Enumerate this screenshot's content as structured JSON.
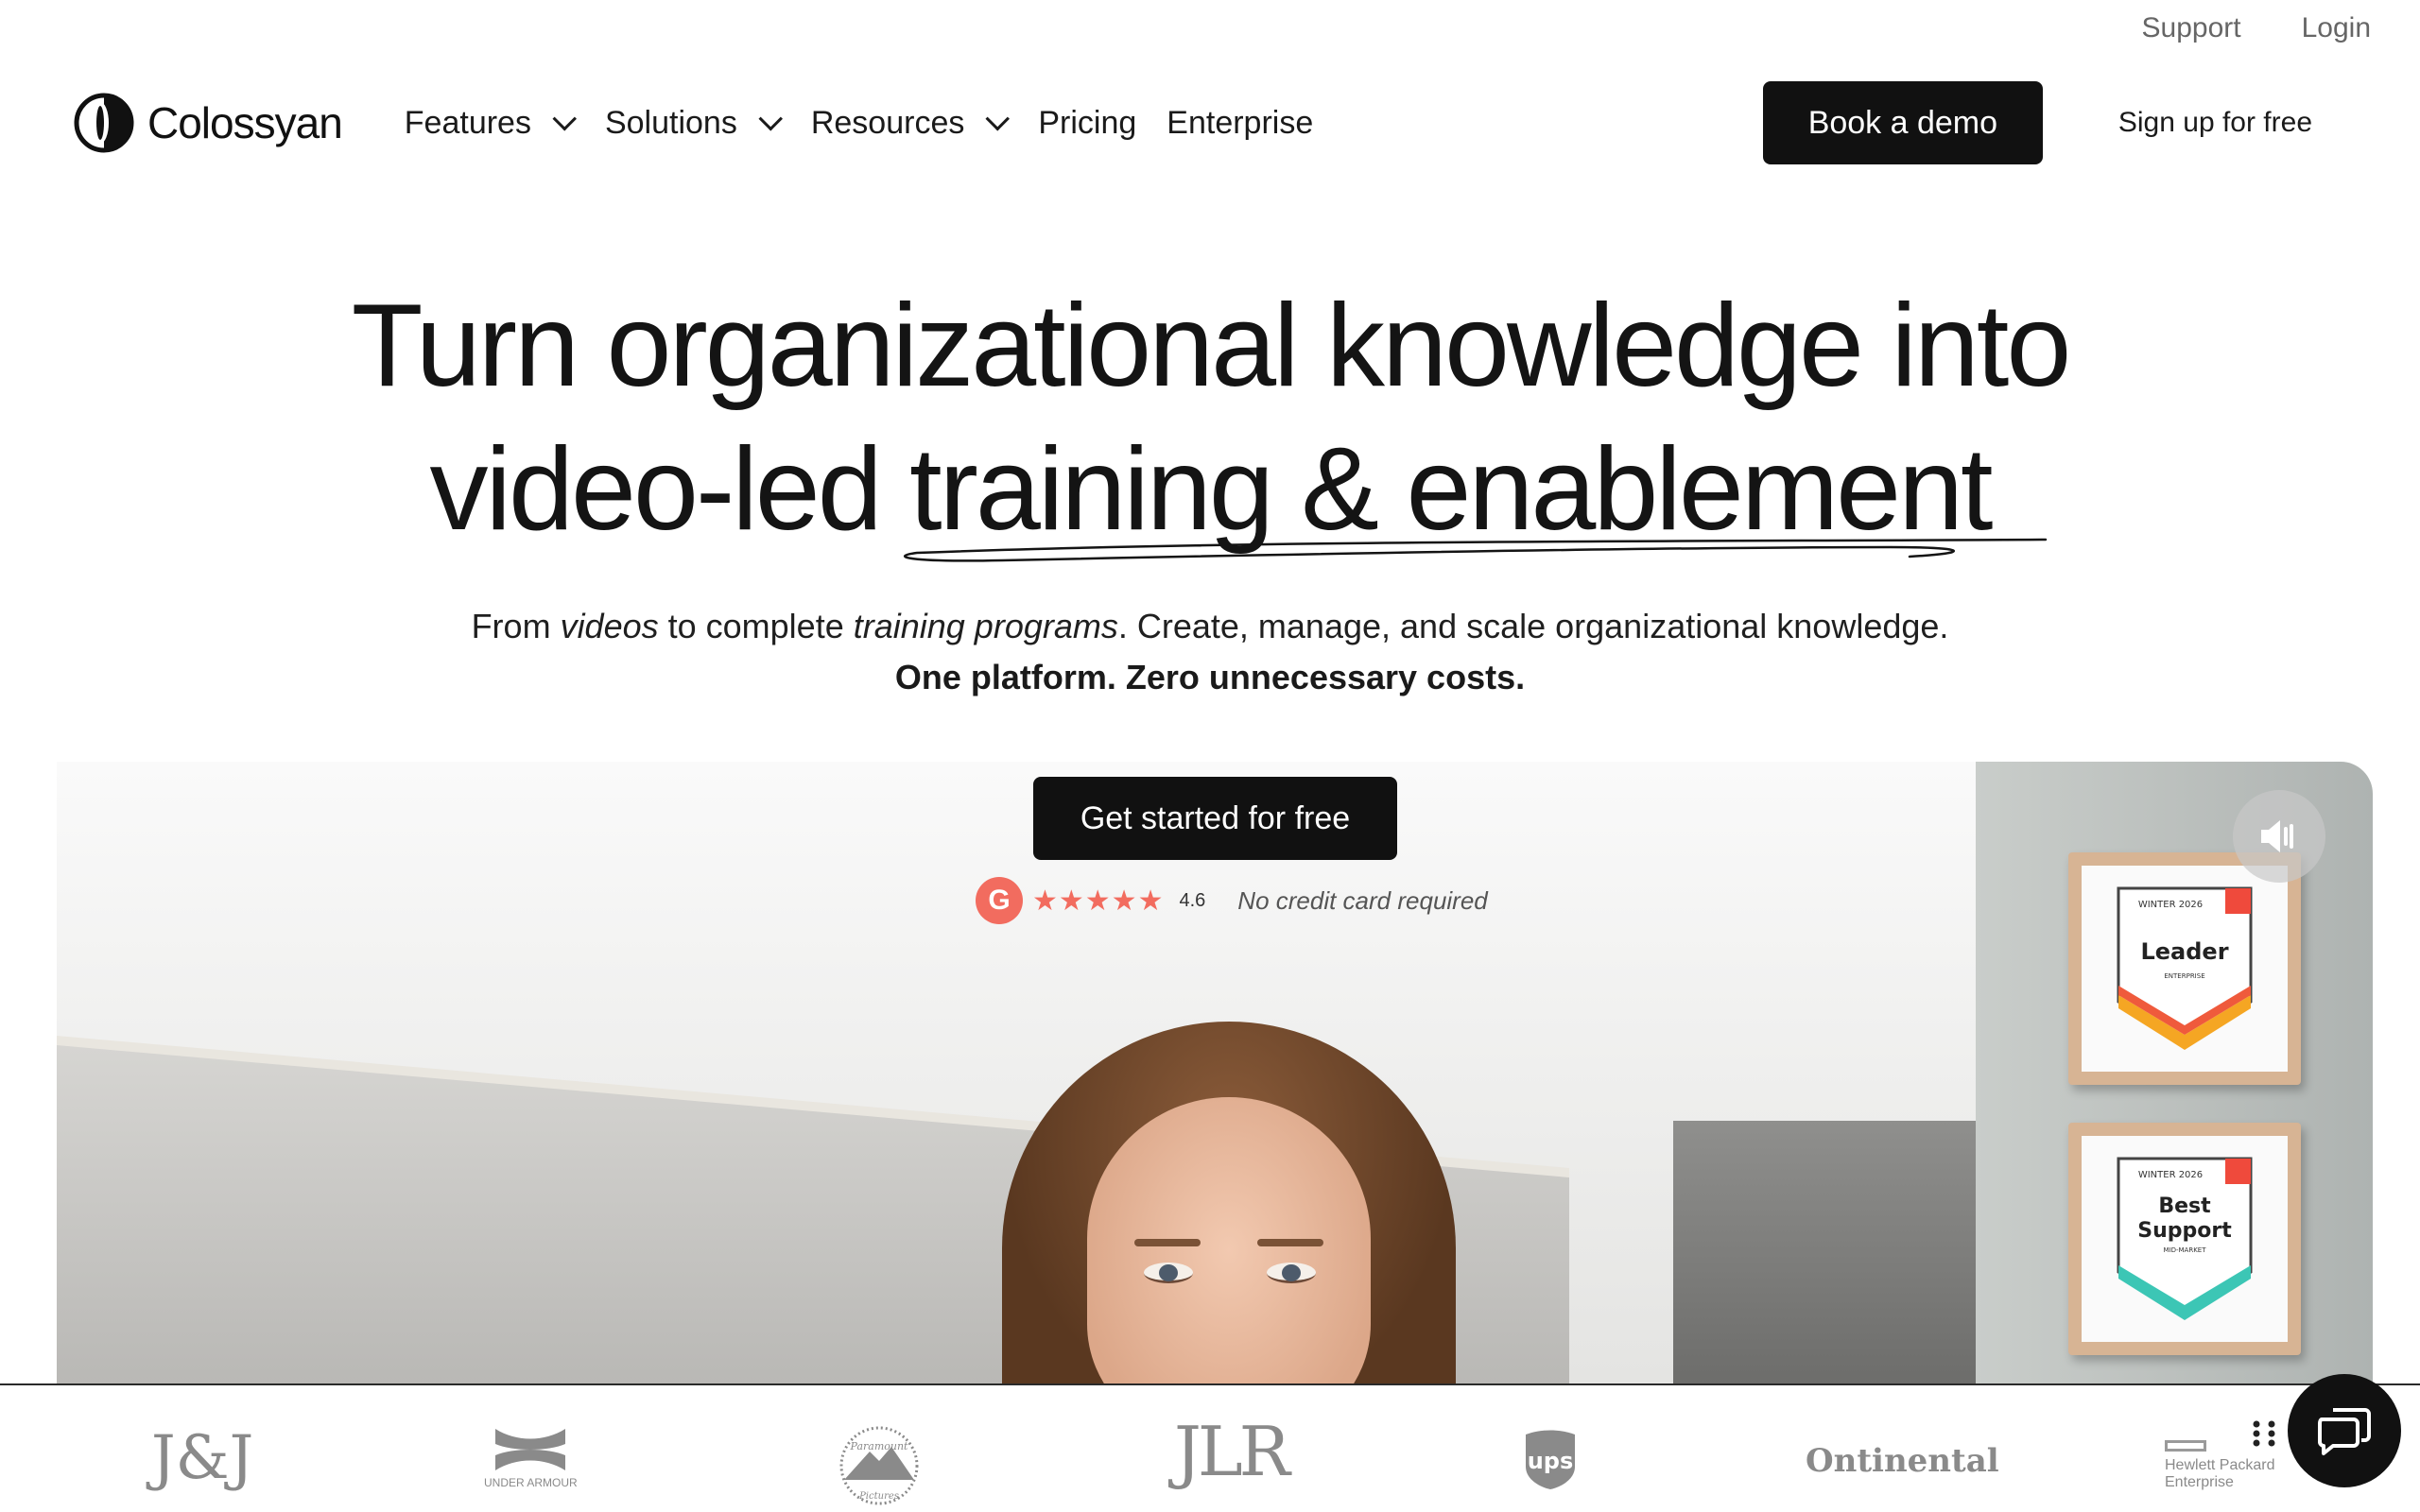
{
  "topbar": {
    "support": "Support",
    "login": "Login"
  },
  "brand": {
    "name": "Colossyan"
  },
  "nav": {
    "features": "Features",
    "solutions": "Solutions",
    "resources": "Resources",
    "pricing": "Pricing",
    "enterprise": "Enterprise",
    "book_demo": "Book a demo",
    "signup": "Sign up for free"
  },
  "hero": {
    "line1": "Turn organizational knowledge into",
    "line2_a": "video-led ",
    "line2_b": "training & enablement",
    "sub_from": "From ",
    "sub_videos": "videos",
    "sub_to": " to complete ",
    "sub_programs": "training programs",
    "sub_rest": ". Create, manage, and scale organizational knowledge.",
    "sub2": "One platform. Zero unnecessary costs.",
    "cta": "Get started for free",
    "rating_score": "4.6",
    "rating_stars": "★★★★★",
    "no_cc": "No credit card required"
  },
  "badges": [
    {
      "season": "WINTER 2026",
      "title": "Leader",
      "segment": "ENTERPRISE"
    },
    {
      "season": "WINTER 2026",
      "title": "Best Support",
      "segment": "MID-MARKET"
    }
  ],
  "logos": {
    "jj": "J&J",
    "ua": "UNDER ARMOUR",
    "paramount": "Paramount",
    "paramount_sub": "Pictures",
    "jlr": "JLR",
    "ups": "ups",
    "continental": "Ontinental",
    "hpe1": "Hewlett Packard",
    "hpe2": "Enterprise"
  },
  "colors": {
    "accent_dark": "#111111",
    "g2_red": "#f26c5f"
  }
}
